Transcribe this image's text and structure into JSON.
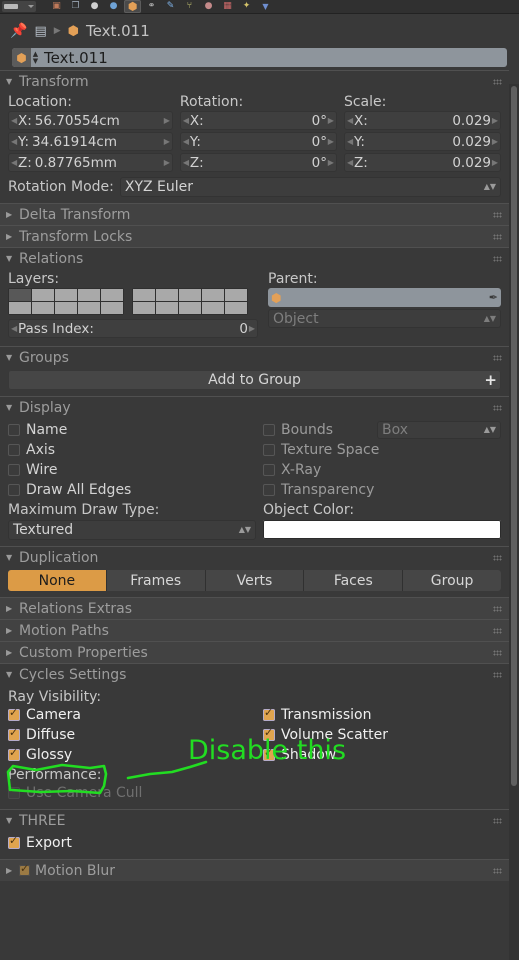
{
  "toolbar": {
    "editor_dropdown": "editor-type-dropdown",
    "icons": [
      {
        "name": "render-icon",
        "glyph": "▣",
        "color": "#c07a5a",
        "active": false
      },
      {
        "name": "render-layers-icon",
        "glyph": "❐",
        "color": "#9aa6b4",
        "active": false
      },
      {
        "name": "scene-icon",
        "glyph": "●",
        "color": "#cfcfcf",
        "active": false
      },
      {
        "name": "world-icon",
        "glyph": "●",
        "color": "#6fa3d6",
        "active": false
      },
      {
        "name": "object-icon",
        "glyph": "⬢",
        "color": "#e3a057",
        "active": true
      },
      {
        "name": "constraints-icon",
        "glyph": "⚭",
        "color": "#b8b8b8",
        "active": false
      },
      {
        "name": "modifiers-icon",
        "glyph": "✎",
        "color": "#7fb3e8",
        "active": false
      },
      {
        "name": "object-data-icon",
        "glyph": "⑂",
        "color": "#c8c873",
        "active": false
      },
      {
        "name": "material-icon",
        "glyph": "●",
        "color": "#c48a8a",
        "active": false
      },
      {
        "name": "texture-icon",
        "glyph": "▦",
        "color": "#d06a6a",
        "active": false
      },
      {
        "name": "particles-icon",
        "glyph": "✦",
        "color": "#d4c36a",
        "active": false
      },
      {
        "name": "physics-icon",
        "glyph": "▼",
        "color": "#6f8fd0",
        "active": false
      }
    ]
  },
  "breadcrumb": {
    "pin_icon": "pin-icon",
    "object_tree_icon": "object-tree-icon",
    "separator": "▶",
    "object_name": "Text.011"
  },
  "name_field": {
    "icon": "object-cube-icon",
    "value": "Text.011"
  },
  "panels": {
    "transform": {
      "title": "Transform",
      "open": true,
      "location_label": "Location:",
      "rotation_label": "Rotation:",
      "scale_label": "Scale:",
      "location": [
        {
          "axis": "X:",
          "value": "56.70554cm"
        },
        {
          "axis": "Y:",
          "value": "34.61914cm"
        },
        {
          "axis": "Z:",
          "value": "0.87765mm"
        }
      ],
      "rotation": [
        {
          "axis": "X:",
          "value": "0°"
        },
        {
          "axis": "Y:",
          "value": "0°"
        },
        {
          "axis": "Z:",
          "value": "0°"
        }
      ],
      "scale": [
        {
          "axis": "X:",
          "value": "0.029"
        },
        {
          "axis": "Y:",
          "value": "0.029"
        },
        {
          "axis": "Z:",
          "value": "0.029"
        }
      ],
      "rotation_mode_label": "Rotation Mode:",
      "rotation_mode_value": "XYZ Euler"
    },
    "delta_transform": {
      "title": "Delta Transform",
      "open": false
    },
    "transform_locks": {
      "title": "Transform Locks",
      "open": false
    },
    "relations": {
      "title": "Relations",
      "open": true,
      "layers_label": "Layers:",
      "layers_group_a_top": [
        true,
        false,
        false,
        false,
        false
      ],
      "layers_group_a_bottom": [
        false,
        false,
        false,
        false,
        false
      ],
      "layers_group_b_top": [
        false,
        false,
        false,
        false,
        false
      ],
      "layers_group_b_bottom": [
        false,
        false,
        false,
        false,
        false
      ],
      "pass_index_label": "Pass Index:",
      "pass_index_value": "0",
      "parent_label": "Parent:",
      "parent_value": "",
      "parent_type_value": "Object"
    },
    "groups": {
      "title": "Groups",
      "open": true,
      "add_to_group_label": "Add to Group",
      "add_icon": "plus-icon"
    },
    "display": {
      "title": "Display",
      "open": true,
      "left_checks": [
        {
          "label": "Name",
          "checked": false
        },
        {
          "label": "Axis",
          "checked": false
        },
        {
          "label": "Wire",
          "checked": false
        },
        {
          "label": "Draw All Edges",
          "checked": false
        }
      ],
      "right_checks": [
        {
          "label": "Bounds",
          "checked": false
        },
        {
          "label": "Texture Space",
          "checked": false
        },
        {
          "label": "X-Ray",
          "checked": false
        },
        {
          "label": "Transparency",
          "checked": false
        }
      ],
      "bounds_select_value": "Box",
      "max_draw_type_label": "Maximum Draw Type:",
      "max_draw_type_value": "Textured",
      "object_color_label": "Object Color:",
      "object_color_value": "#ffffff"
    },
    "duplication": {
      "title": "Duplication",
      "open": true,
      "options": [
        "None",
        "Frames",
        "Verts",
        "Faces",
        "Group"
      ],
      "selected": "None",
      "selected_color": "#dc9b46"
    },
    "relations_extras": {
      "title": "Relations Extras",
      "open": false
    },
    "motion_paths": {
      "title": "Motion Paths",
      "open": false
    },
    "custom_properties": {
      "title": "Custom Properties",
      "open": false
    },
    "cycles_settings": {
      "title": "Cycles Settings",
      "open": true,
      "ray_visibility_label": "Ray Visibility:",
      "left_checks": [
        {
          "label": "Camera",
          "checked": true
        },
        {
          "label": "Diffuse",
          "checked": true
        },
        {
          "label": "Glossy",
          "checked": true
        }
      ],
      "right_checks": [
        {
          "label": "Transmission",
          "checked": true
        },
        {
          "label": "Volume Scatter",
          "checked": true
        },
        {
          "label": "Shadow",
          "checked": true
        }
      ],
      "performance_label": "Performance:",
      "camera_cull": {
        "label": "Use Camera Cull",
        "checked": false
      }
    },
    "three": {
      "title": "THREE",
      "open": true,
      "export": {
        "label": "Export",
        "checked": true
      }
    },
    "motion_blur": {
      "title": "Motion Blur",
      "open": false,
      "checked": true
    }
  },
  "annotation": {
    "text": "Disable this",
    "color": "#22dd22",
    "target": "Camera",
    "marker": "hand-drawn-box-and-arrow"
  }
}
